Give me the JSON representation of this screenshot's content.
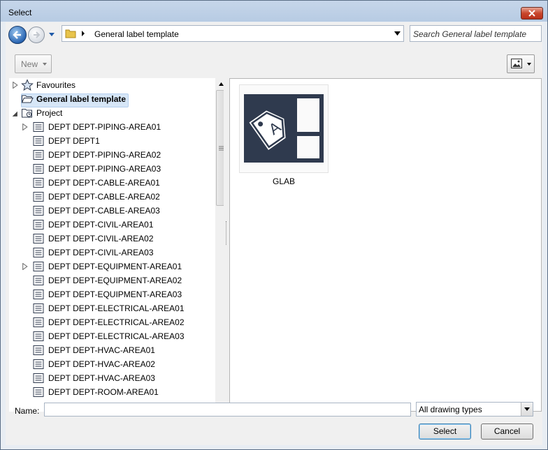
{
  "window": {
    "title": "Select"
  },
  "nav": {
    "address_path": "General label template",
    "search_placeholder": "Search General label template"
  },
  "toolbar": {
    "new_label": "New"
  },
  "tree": {
    "favourites": "Favourites",
    "general_label_template": "General label template",
    "project": "Project",
    "items": [
      {
        "label": "DEPT DEPT-PIPING-AREA01",
        "expandable": true
      },
      {
        "label": "DEPT DEPT1",
        "expandable": false
      },
      {
        "label": "DEPT DEPT-PIPING-AREA02",
        "expandable": false
      },
      {
        "label": "DEPT DEPT-PIPING-AREA03",
        "expandable": false
      },
      {
        "label": "DEPT DEPT-CABLE-AREA01",
        "expandable": false
      },
      {
        "label": "DEPT DEPT-CABLE-AREA02",
        "expandable": false
      },
      {
        "label": "DEPT DEPT-CABLE-AREA03",
        "expandable": false
      },
      {
        "label": "DEPT DEPT-CIVIL-AREA01",
        "expandable": false
      },
      {
        "label": "DEPT DEPT-CIVIL-AREA02",
        "expandable": false
      },
      {
        "label": "DEPT DEPT-CIVIL-AREA03",
        "expandable": false
      },
      {
        "label": "DEPT DEPT-EQUIPMENT-AREA01",
        "expandable": true
      },
      {
        "label": "DEPT DEPT-EQUIPMENT-AREA02",
        "expandable": false
      },
      {
        "label": "DEPT DEPT-EQUIPMENT-AREA03",
        "expandable": false
      },
      {
        "label": "DEPT DEPT-ELECTRICAL-AREA01",
        "expandable": false
      },
      {
        "label": "DEPT DEPT-ELECTRICAL-AREA02",
        "expandable": false
      },
      {
        "label": "DEPT DEPT-ELECTRICAL-AREA03",
        "expandable": false
      },
      {
        "label": "DEPT DEPT-HVAC-AREA01",
        "expandable": false
      },
      {
        "label": "DEPT DEPT-HVAC-AREA02",
        "expandable": false
      },
      {
        "label": "DEPT DEPT-HVAC-AREA03",
        "expandable": false
      },
      {
        "label": "DEPT DEPT-ROOM-AREA01",
        "expandable": false
      }
    ]
  },
  "content": {
    "items": [
      {
        "label": "GLAB",
        "icon": "label-template-icon"
      }
    ]
  },
  "footer": {
    "name_label": "Name:",
    "name_value": "",
    "type_value": "All drawing types",
    "select_label": "Select",
    "cancel_label": "Cancel"
  },
  "colors": {
    "selection": "#d6e6f7",
    "icon_dark": "#2f3a4e",
    "title_gradient": "#c6d6ea"
  }
}
